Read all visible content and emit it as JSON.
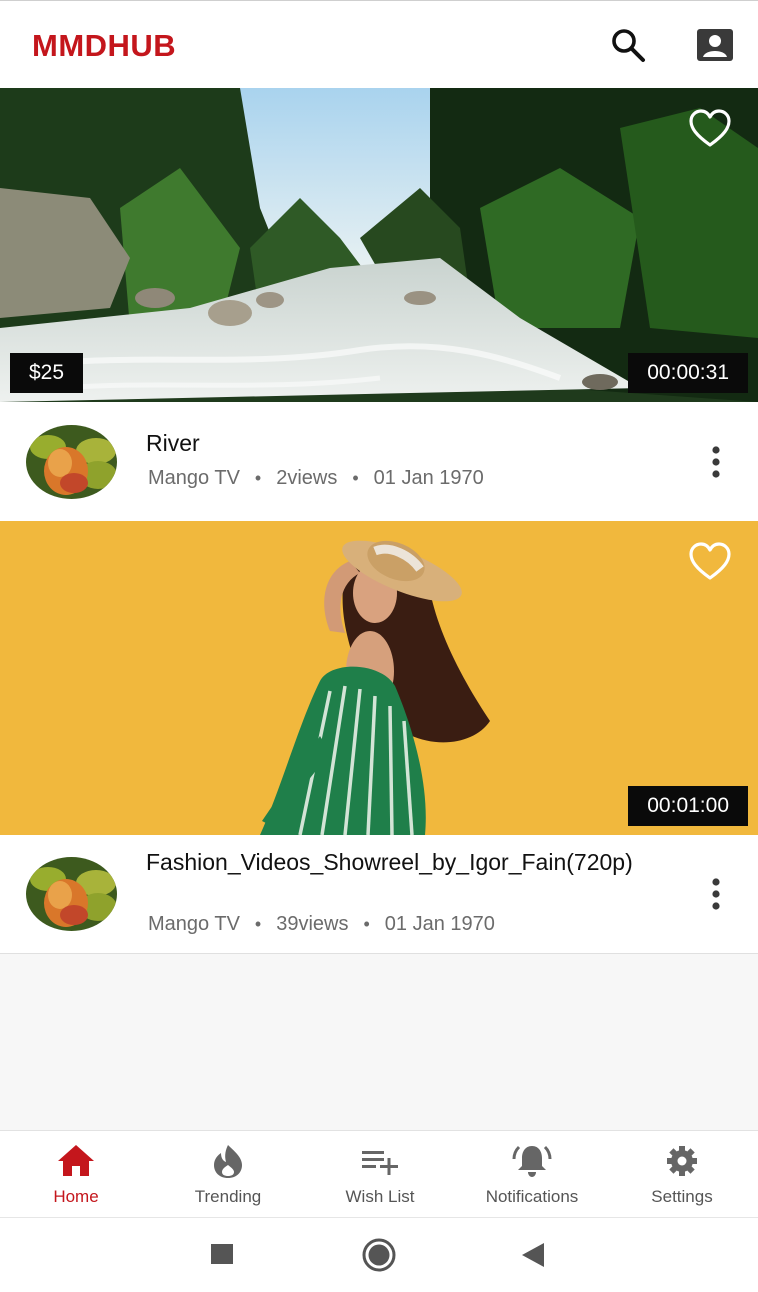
{
  "header": {
    "logo_text": "MMDHUB",
    "brand_color": "#c4161c",
    "search_icon": "search-icon",
    "account_icon": "account-box-icon"
  },
  "videos": [
    {
      "thumbnail": "mountain river between pine forests",
      "price": "$25",
      "duration": "00:00:31",
      "title": "River",
      "channel": "Mango TV",
      "views": "2views",
      "date": "01 Jan 1970",
      "favorite_icon": "heart-outline-icon",
      "menu_icon": "more-vertical-icon"
    },
    {
      "thumbnail": "woman in green dress and straw hat on yellow background",
      "duration": "00:01:00",
      "title": "Fashion_Videos_Showreel_by_Igor_Fain(720p)",
      "channel": "Mango TV",
      "views": "39views",
      "date": "01 Jan 1970",
      "favorite_icon": "heart-outline-icon",
      "menu_icon": "more-vertical-icon"
    }
  ],
  "bottom_nav": {
    "active_color": "#c4161c",
    "items": [
      {
        "label": "Home",
        "icon": "home-icon",
        "active": true
      },
      {
        "label": "Trending",
        "icon": "flame-icon",
        "active": false
      },
      {
        "label": "Wish List",
        "icon": "playlist-add-icon",
        "active": false
      },
      {
        "label": "Notifications",
        "icon": "bell-icon",
        "active": false
      },
      {
        "label": "Settings",
        "icon": "gear-icon",
        "active": false
      }
    ]
  },
  "system_nav": {
    "icons": [
      "recents-square-icon",
      "home-circle-icon",
      "back-triangle-icon"
    ]
  }
}
